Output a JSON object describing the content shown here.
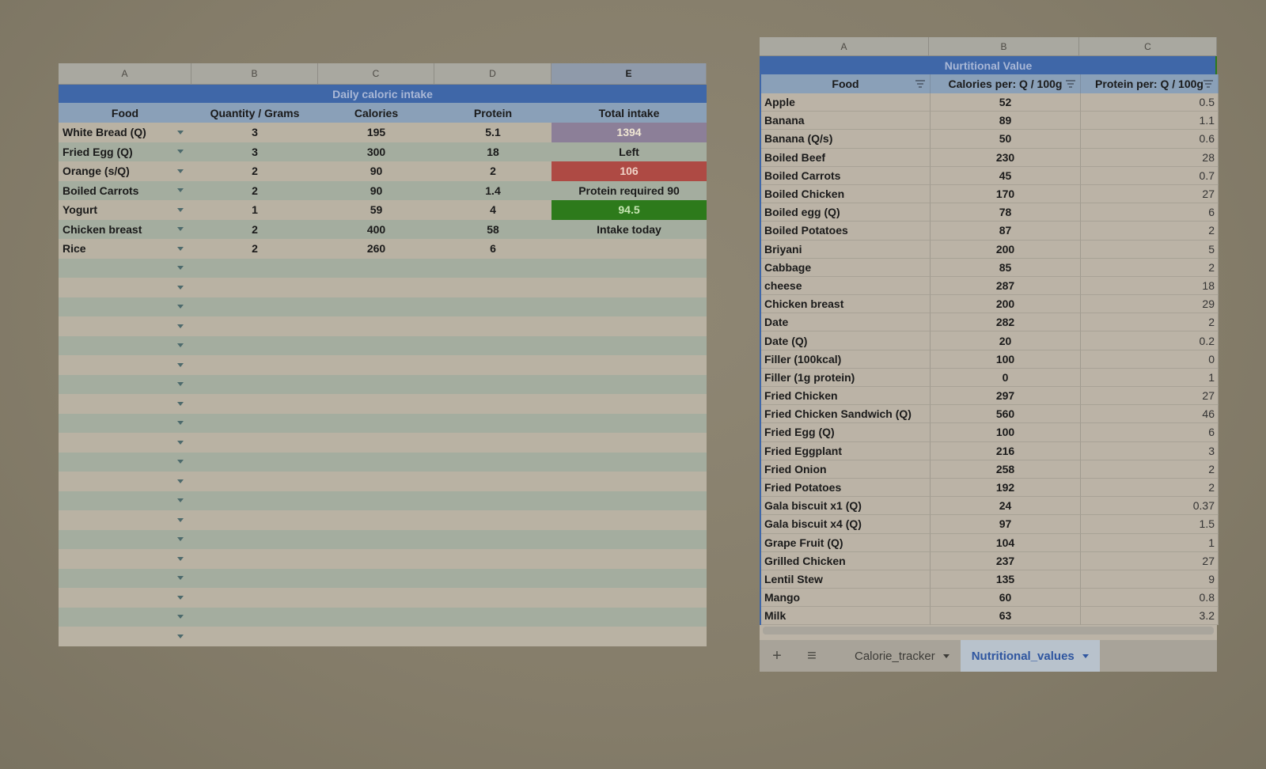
{
  "calorie_sheet": {
    "columns": [
      "A",
      "B",
      "C",
      "D",
      "E"
    ],
    "active_column": "E",
    "title": "Daily caloric intake",
    "headers": [
      "Food",
      "Quantity / Grams",
      "Calories",
      "Protein",
      "Total intake"
    ],
    "rows": [
      {
        "food": "White Bread (Q)",
        "qty": "3",
        "cal": "195",
        "protein": "5.1",
        "total": "1394"
      },
      {
        "food": "Fried Egg (Q)",
        "qty": "3",
        "cal": "300",
        "protein": "18",
        "total": "Left"
      },
      {
        "food": "Orange (s/Q)",
        "qty": "2",
        "cal": "90",
        "protein": "2",
        "total": "106"
      },
      {
        "food": "Boiled Carrots",
        "qty": "2",
        "cal": "90",
        "protein": "1.4",
        "total": "Protein required 90"
      },
      {
        "food": "Yogurt",
        "qty": "1",
        "cal": "59",
        "protein": "4",
        "total": "94.5"
      },
      {
        "food": "Chicken breast",
        "qty": "2",
        "cal": "400",
        "protein": "58",
        "total": "Intake today"
      },
      {
        "food": "Rice",
        "qty": "2",
        "cal": "260",
        "protein": "6",
        "total": ""
      },
      {
        "food": "",
        "qty": "",
        "cal": "",
        "protein": "",
        "total": ""
      },
      {
        "food": "",
        "qty": "",
        "cal": "",
        "protein": "",
        "total": ""
      },
      {
        "food": "",
        "qty": "",
        "cal": "",
        "protein": "",
        "total": ""
      },
      {
        "food": "",
        "qty": "",
        "cal": "",
        "protein": "",
        "total": ""
      },
      {
        "food": "",
        "qty": "",
        "cal": "",
        "protein": "",
        "total": ""
      },
      {
        "food": "",
        "qty": "",
        "cal": "",
        "protein": "",
        "total": ""
      },
      {
        "food": "",
        "qty": "",
        "cal": "",
        "protein": "",
        "total": ""
      },
      {
        "food": "",
        "qty": "",
        "cal": "",
        "protein": "",
        "total": ""
      },
      {
        "food": "",
        "qty": "",
        "cal": "",
        "protein": "",
        "total": ""
      },
      {
        "food": "",
        "qty": "",
        "cal": "",
        "protein": "",
        "total": ""
      },
      {
        "food": "",
        "qty": "",
        "cal": "",
        "protein": "",
        "total": ""
      },
      {
        "food": "",
        "qty": "",
        "cal": "",
        "protein": "",
        "total": ""
      },
      {
        "food": "",
        "qty": "",
        "cal": "",
        "protein": "",
        "total": ""
      },
      {
        "food": "",
        "qty": "",
        "cal": "",
        "protein": "",
        "total": ""
      },
      {
        "food": "",
        "qty": "",
        "cal": "",
        "protein": "",
        "total": ""
      },
      {
        "food": "",
        "qty": "",
        "cal": "",
        "protein": "",
        "total": ""
      },
      {
        "food": "",
        "qty": "",
        "cal": "",
        "protein": "",
        "total": ""
      },
      {
        "food": "",
        "qty": "",
        "cal": "",
        "protein": "",
        "total": ""
      },
      {
        "food": "",
        "qty": "",
        "cal": "",
        "protein": "",
        "total": ""
      },
      {
        "food": "",
        "qty": "",
        "cal": "",
        "protein": "",
        "total": ""
      }
    ],
    "highlight_colors": {
      "purple": "#8c7f98",
      "red": "#ae4a44",
      "green": "#2d7a1b"
    }
  },
  "nutrition_sheet": {
    "columns": [
      "A",
      "B",
      "C"
    ],
    "title": "Nurtitional Value",
    "headers": [
      "Food",
      "Calories per: Q / 100g",
      "Protein per: Q / 100g"
    ],
    "rows": [
      [
        "Apple",
        "52",
        "0.5"
      ],
      [
        "Banana",
        "89",
        "1.1"
      ],
      [
        "Banana (Q/s)",
        "50",
        "0.6"
      ],
      [
        "Boiled Beef",
        "230",
        "28"
      ],
      [
        "Boiled Carrots",
        "45",
        "0.7"
      ],
      [
        "Boiled Chicken",
        "170",
        "27"
      ],
      [
        "Boiled egg (Q)",
        "78",
        "6"
      ],
      [
        "Boiled Potatoes",
        "87",
        "2"
      ],
      [
        "Briyani",
        "200",
        "5"
      ],
      [
        "Cabbage",
        "85",
        "2"
      ],
      [
        "cheese",
        "287",
        "18"
      ],
      [
        "Chicken breast",
        "200",
        "29"
      ],
      [
        "Date",
        "282",
        "2"
      ],
      [
        "Date (Q)",
        "20",
        "0.2"
      ],
      [
        "Filler (100kcal)",
        "100",
        "0"
      ],
      [
        "Filler (1g protein)",
        "0",
        "1"
      ],
      [
        "Fried Chicken",
        "297",
        "27"
      ],
      [
        "Fried Chicken Sandwich (Q)",
        "560",
        "46"
      ],
      [
        "Fried Egg (Q)",
        "100",
        "6"
      ],
      [
        "Fried Eggplant",
        "216",
        "3"
      ],
      [
        "Fried Onion",
        "258",
        "2"
      ],
      [
        "Fried Potatoes",
        "192",
        "2"
      ],
      [
        "Gala biscuit x1 (Q)",
        "24",
        "0.37"
      ],
      [
        "Gala biscuit x4 (Q)",
        "97",
        "1.5"
      ],
      [
        "Grape Fruit (Q)",
        "104",
        "1"
      ],
      [
        "Grilled Chicken",
        "237",
        "27"
      ],
      [
        "Lentil Stew",
        "135",
        "9"
      ],
      [
        "Mango",
        "60",
        "0.8"
      ],
      [
        "Milk",
        "63",
        "3.2"
      ]
    ],
    "tabs": {
      "add": "+",
      "menu": "≡",
      "sheets": [
        {
          "label": "Calorie_tracker",
          "active": false
        },
        {
          "label": "Nutritional_values",
          "active": true
        }
      ]
    }
  }
}
